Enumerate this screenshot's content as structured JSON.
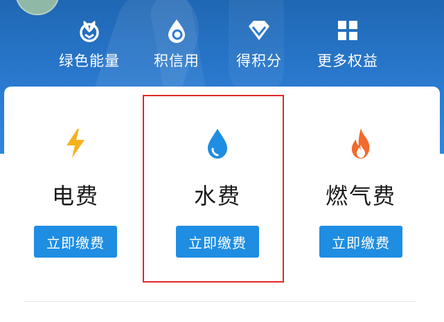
{
  "header": {
    "quick_links": [
      {
        "label": "绿色能量",
        "icon": "sprout-icon"
      },
      {
        "label": "积信用",
        "icon": "drop-credit-icon"
      },
      {
        "label": "得积分",
        "icon": "diamond-icon"
      },
      {
        "label": "更多权益",
        "icon": "grid-icon"
      }
    ]
  },
  "bills": [
    {
      "name": "电费",
      "button": "立即缴费",
      "icon": "lightning-icon",
      "color": "#f5b21c"
    },
    {
      "name": "水费",
      "button": "立即缴费",
      "icon": "water-drop-icon",
      "color": "#1e8de2"
    },
    {
      "name": "燃气费",
      "button": "立即缴费",
      "icon": "flame-icon",
      "color": "#f26a2e"
    }
  ],
  "colors": {
    "header_blue": "#2a7ad0",
    "button_blue": "#1e8de2",
    "highlight_red": "#e0282a"
  }
}
